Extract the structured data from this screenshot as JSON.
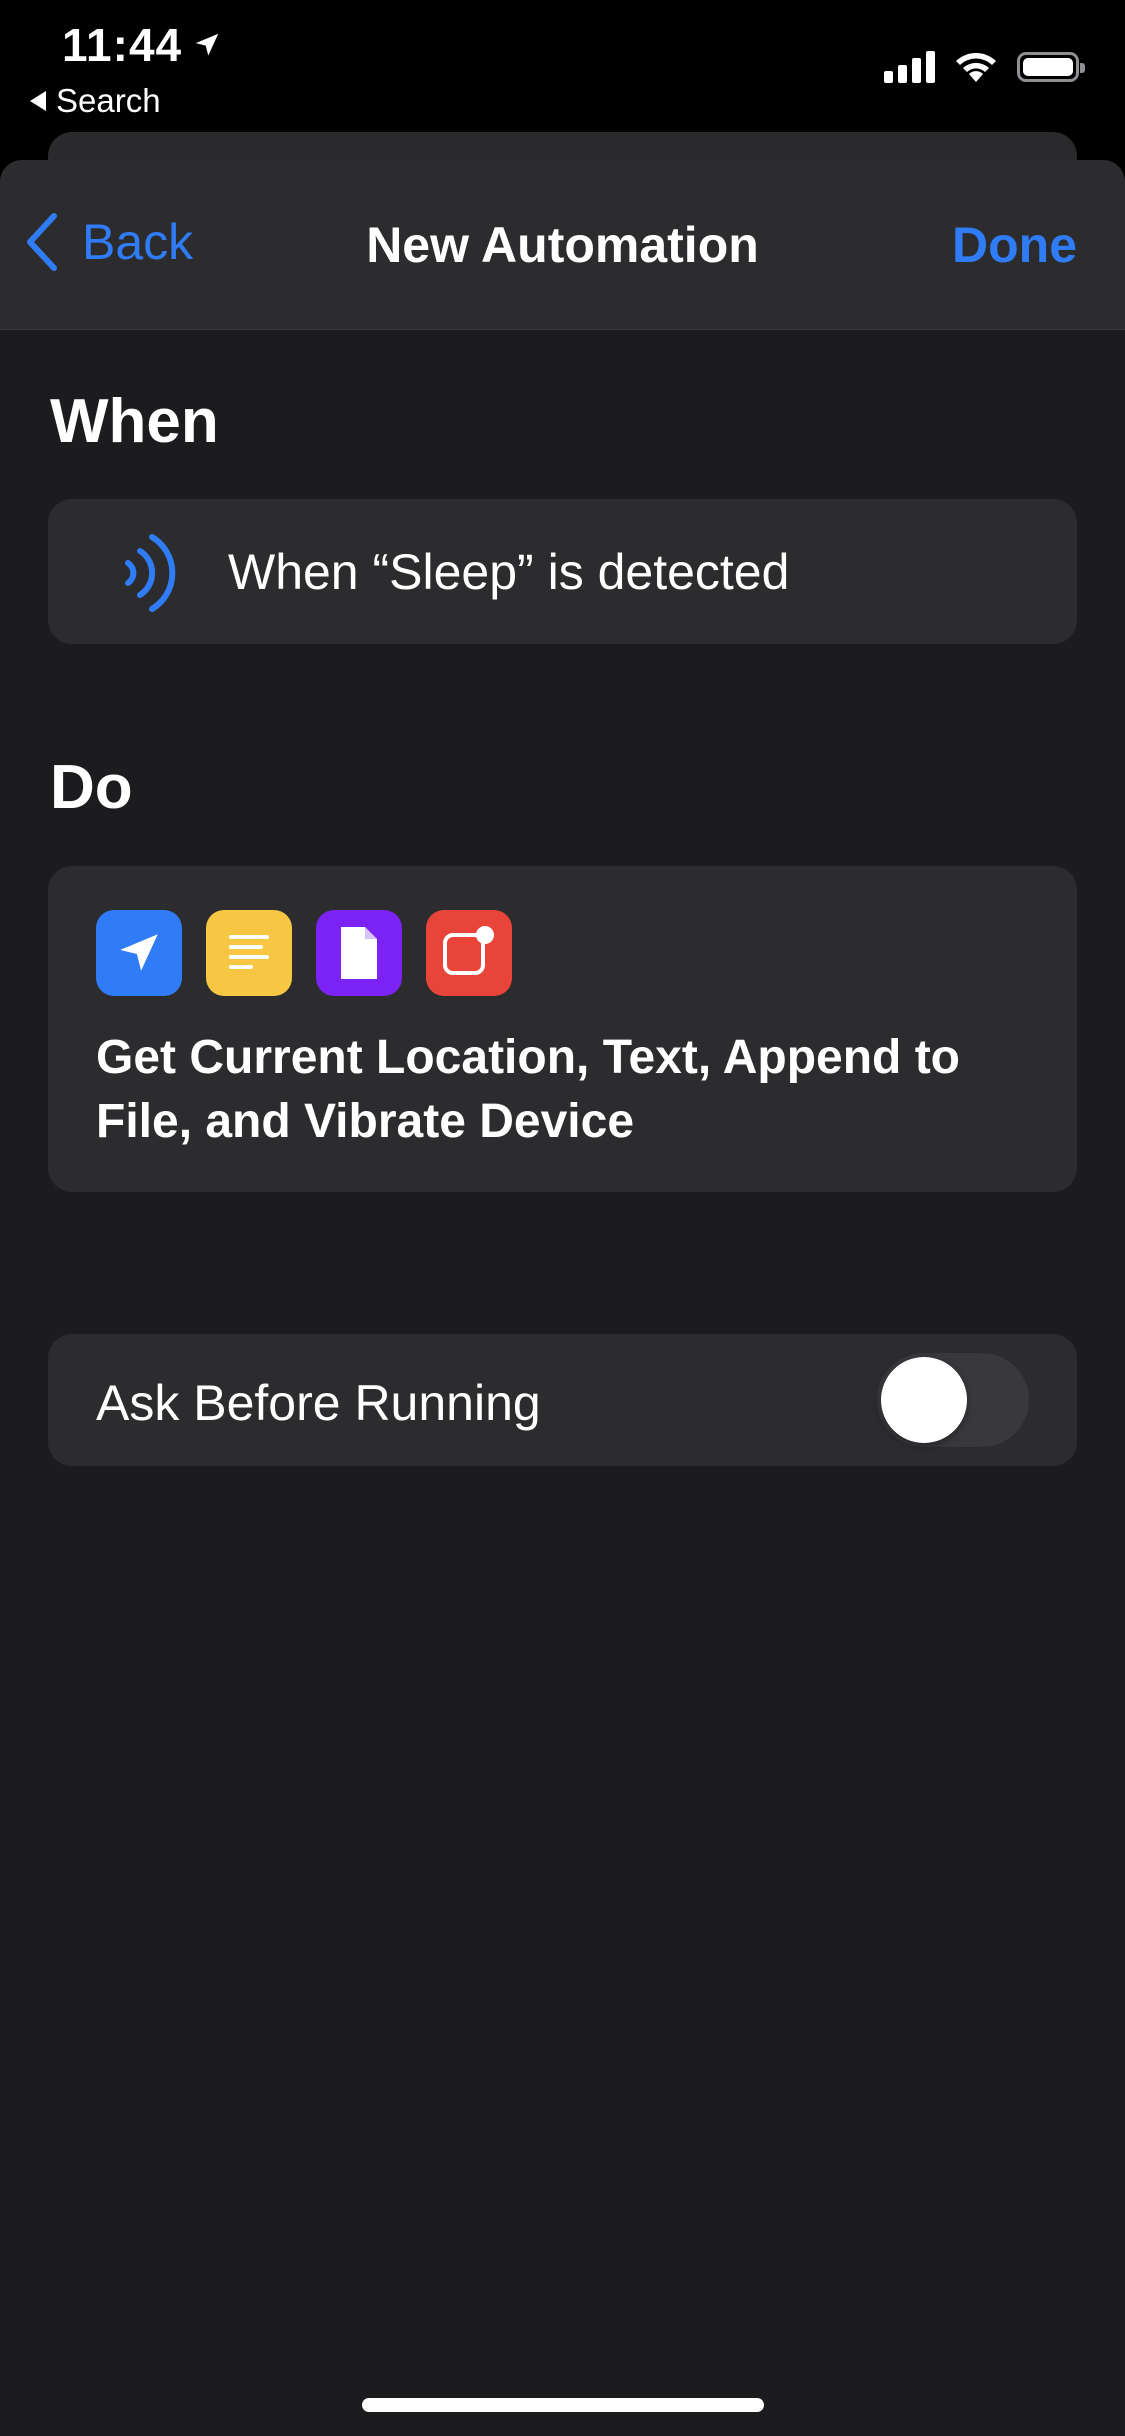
{
  "status_bar": {
    "time": "11:44",
    "back_app": "Search",
    "location_icon": "location-arrow-icon",
    "signal_icon": "cellular-signal-icon",
    "wifi_icon": "wifi-icon",
    "battery_icon": "battery-icon"
  },
  "nav": {
    "back_label": "Back",
    "title": "New Automation",
    "done_label": "Done"
  },
  "when": {
    "heading": "When",
    "trigger_text": "When “Sleep” is detected",
    "trigger_icon": "sleep-detection-icon"
  },
  "do": {
    "heading": "Do",
    "actions": [
      {
        "icon": "location-icon",
        "color": "#2f7cf6"
      },
      {
        "icon": "text-icon",
        "color": "#f7c744"
      },
      {
        "icon": "file-icon",
        "color": "#7b22f5"
      },
      {
        "icon": "vibrate-device-icon",
        "color": "#e8443a"
      }
    ],
    "summary": "Get Current Location, Text, Append to File, and Vibrate Device"
  },
  "ask_before_running": {
    "label": "Ask Before Running",
    "enabled": false
  },
  "colors": {
    "accent": "#2f7cf6",
    "background": "#1c1c1e",
    "card": "#2c2c2e"
  }
}
